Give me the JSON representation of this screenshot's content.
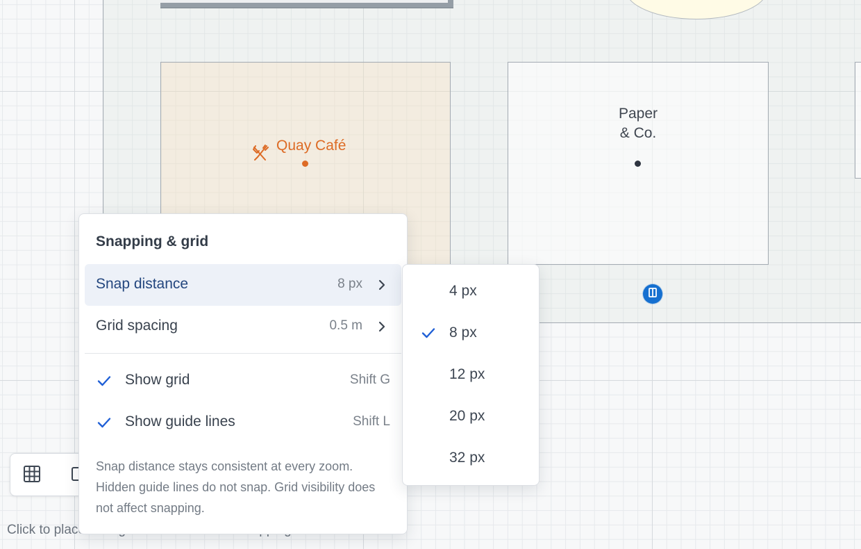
{
  "canvas": {
    "shops": [
      {
        "name": "Quay Café",
        "color": "#dd6b25",
        "icon": "fork-knife-icon"
      },
      {
        "name": "Paper\n& Co.",
        "color": "#3f4650"
      }
    ],
    "door_marker_icon": "door-icon"
  },
  "toolbar": {
    "tools": [
      {
        "icon": "grid-icon"
      },
      {
        "icon": "rectangle-icon"
      }
    ]
  },
  "status_hint": "Click to place · Drag to move · Hold for snapping · Esc to select",
  "menu": {
    "title": "Snapping & grid",
    "items": [
      {
        "label": "Snap distance",
        "value": "8 px",
        "icon": "chevron-right-icon",
        "active": true
      },
      {
        "label": "Grid spacing",
        "value": "0.5 m",
        "icon": "chevron-right-icon"
      }
    ],
    "toggles": [
      {
        "label": "Show grid",
        "shortcut": "Shift G",
        "checked": true,
        "icon": "check-icon"
      },
      {
        "label": "Show guide lines",
        "shortcut": "Shift L",
        "checked": true,
        "icon": "check-icon"
      }
    ],
    "note": "Snap distance stays consistent at every zoom. Hidden guide lines do not snap. Grid visibility does not affect snapping."
  },
  "submenu": {
    "options": [
      {
        "label": "4 px",
        "selected": false
      },
      {
        "label": "8 px",
        "selected": true
      },
      {
        "label": "12 px",
        "selected": false
      },
      {
        "label": "20 px",
        "selected": false
      },
      {
        "label": "32 px",
        "selected": false
      }
    ]
  },
  "colors": {
    "accent": "#1f5fd6",
    "highlight": "#edf1f8",
    "door": "#1670d0",
    "cafe": "#dd6b25"
  }
}
